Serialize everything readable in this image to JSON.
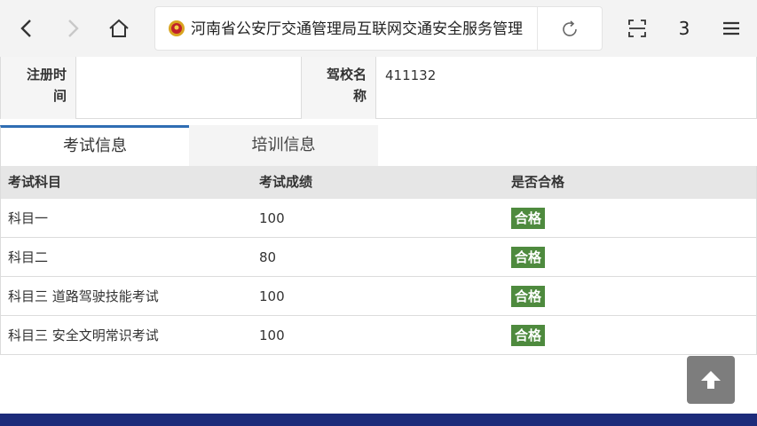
{
  "browser": {
    "url_title": "河南省公安厅交通管理局互联网交通安全服务管理",
    "tab_count": "3",
    "icons": [
      "back-icon",
      "forward-icon",
      "home-icon",
      "police-badge-icon",
      "reload-icon",
      "scan-icon",
      "menu-icon"
    ]
  },
  "info": {
    "reg_time_label": "注册时间",
    "reg_time_value": "",
    "school_label": "驾校名称",
    "school_value": "411132"
  },
  "tabs": [
    {
      "label": "考试信息",
      "active": true
    },
    {
      "label": "培训信息",
      "active": false
    }
  ],
  "table": {
    "headers": [
      "考试科目",
      "考试成绩",
      "是否合格"
    ],
    "rows": [
      {
        "subject": "科目一",
        "score": "100",
        "result": "合格"
      },
      {
        "subject": "科目二",
        "score": "80",
        "result": "合格"
      },
      {
        "subject": "科目三 道路驾驶技能考试",
        "score": "100",
        "result": "合格"
      },
      {
        "subject": "科目三 安全文明常识考试",
        "score": "100",
        "result": "合格"
      }
    ]
  },
  "colors": {
    "accent": "#2f6db3",
    "pass_badge": "#4e8a3e",
    "footer": "#1d2b7a"
  }
}
